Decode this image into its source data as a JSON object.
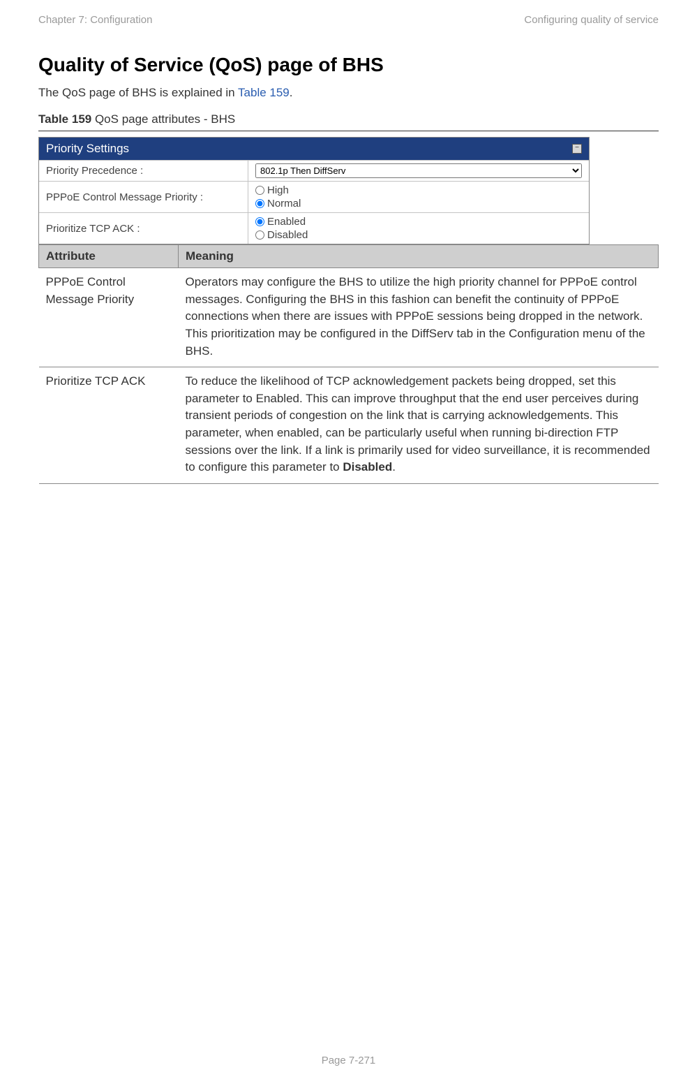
{
  "header": {
    "left": "Chapter 7:  Configuration",
    "right": "Configuring quality of service"
  },
  "section_title": "Quality of Service (QoS) page of BHS",
  "intro": {
    "pre": "The QoS page of BHS is explained in ",
    "link": "Table 159",
    "post": "."
  },
  "table_caption": {
    "bold": "Table 159",
    "rest": " QoS page attributes - BHS"
  },
  "panel": {
    "title": "Priority Settings",
    "rows": {
      "precedence": {
        "label": "Priority Precedence :",
        "select_value": "802.1p Then DiffServ"
      },
      "pppoe": {
        "label": "PPPoE Control Message Priority :",
        "opt_high": "High",
        "opt_normal": "Normal"
      },
      "tcpack": {
        "label": "Prioritize TCP ACK :",
        "opt_enabled": "Enabled",
        "opt_disabled": "Disabled"
      }
    }
  },
  "attr_table": {
    "head": {
      "attribute": "Attribute",
      "meaning": "Meaning"
    },
    "rows": [
      {
        "attribute": "PPPoE Control Message Priority",
        "meaning": "Operators may configure the BHS to utilize the high priority channel for PPPoE control messages. Configuring the BHS in this fashion can benefit the continuity of PPPoE connections when there are issues with PPPoE sessions being dropped in the network. This prioritization may be configured in the DiffServ tab in the Configuration menu of the BHS."
      },
      {
        "attribute": "Prioritize TCP ACK",
        "meaning_pre": "To reduce the likelihood of TCP acknowledgement packets being dropped, set this parameter to Enabled. This can improve throughput that the end user perceives during transient periods of congestion on the link that is carrying acknowledgements. This parameter, when enabled, can be particularly useful when running bi-direction FTP sessions over the link. If a link is primarily used for video surveillance, it is recommended to configure this parameter to ",
        "meaning_bold": "Disabled",
        "meaning_post": "."
      }
    ]
  },
  "footer": "Page 7-271"
}
